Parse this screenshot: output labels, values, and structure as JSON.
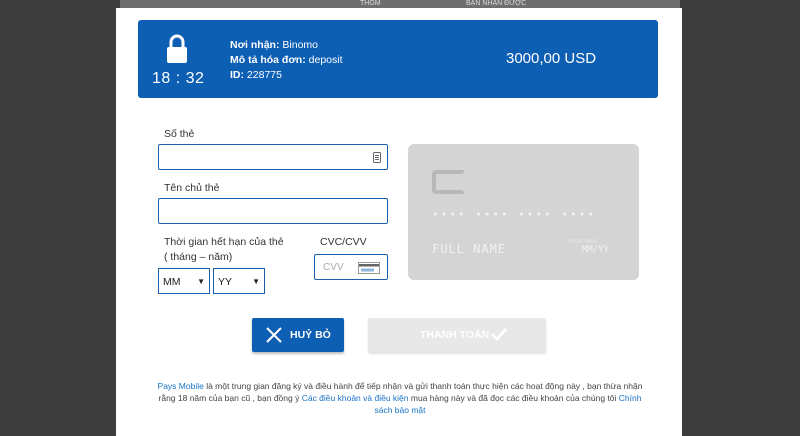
{
  "background": {
    "strip_left": "",
    "strip_mid": "THGM",
    "strip_right": "BẠN NHẬN ĐƯỢC"
  },
  "header": {
    "timer": "18 : 32",
    "recipient_label": "Nơi nhận:",
    "recipient_value": "Binomo",
    "description_label": "Mô tả hóa đơn:",
    "description_value": "deposit",
    "id_label": "ID:",
    "id_value": "228775",
    "amount": "3000,00 USD",
    "color": "#0d5fb3"
  },
  "form": {
    "card_number_label": "Số thẻ",
    "card_number_value": "",
    "cardholder_label": "Tên chủ thẻ",
    "cardholder_value": "",
    "expiry_label_line1": "Thời gian hết hạn của thẻ",
    "expiry_label_line2": "( tháng – năm)",
    "month_value": "MM",
    "year_value": "YY",
    "cvc_label": "CVC/CVV",
    "cvc_placeholder": "CVV"
  },
  "card_preview": {
    "number_mask": "•••• •••• •••• ••••",
    "full_name": "FULL NAME",
    "valid_thru": "VALID THRU",
    "mmyy": "MM/YY"
  },
  "buttons": {
    "cancel_label": "HUỶ BỎ",
    "pay_label": "THANH TOÁN"
  },
  "footer": {
    "link_pays": "Pays Mobile",
    "text1": " là một trung gian đăng ký và điều hành để tiếp nhận và gửi thanh toán thực hiện các hoạt động này , bạn thừa nhận rằng 18 năm của bạn cũ , bạn đồng ý ",
    "link_terms": "Các điều khoản và điều kiện",
    "text2": " mua hàng này và đã đọc các điều khoản của chúng tôi ",
    "link_privacy": "Chính sách bảo mật"
  }
}
